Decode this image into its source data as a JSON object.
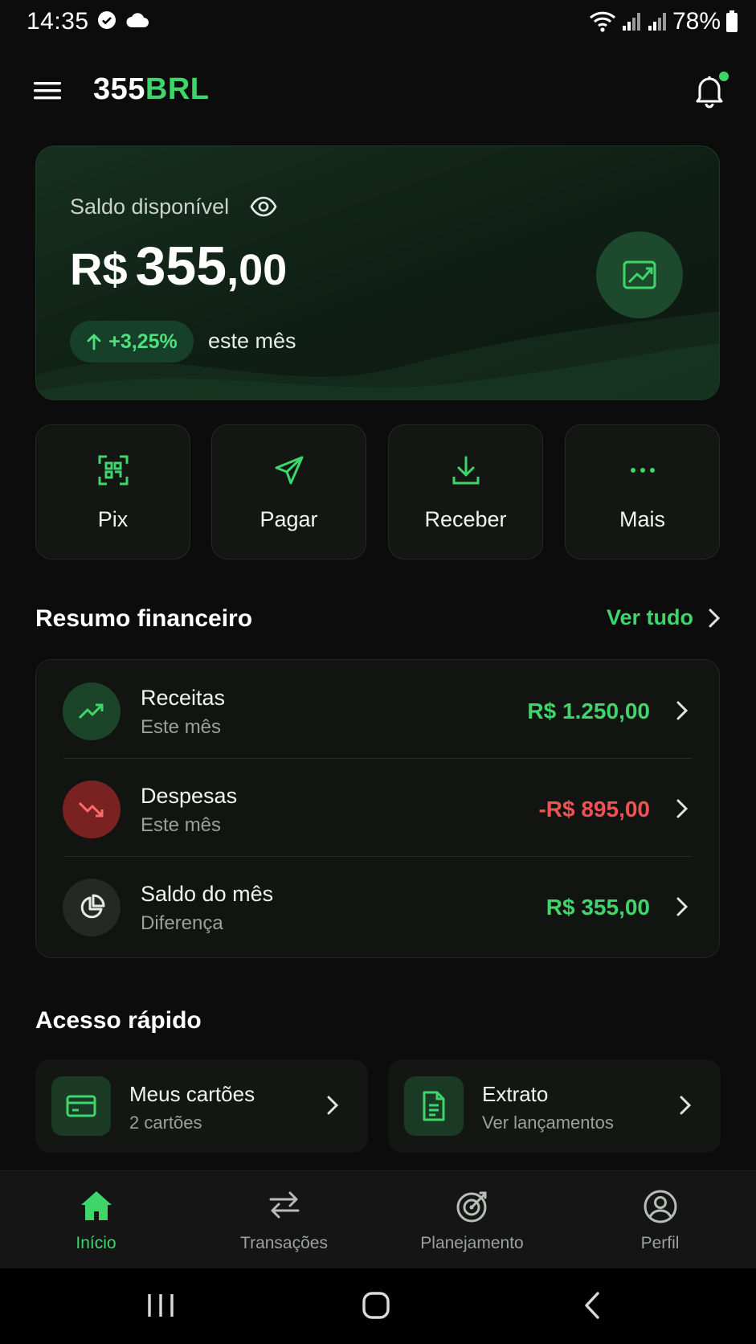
{
  "status_bar": {
    "time": "14:35",
    "battery_text": "78%",
    "icons": [
      "check-circle-icon",
      "cloud-icon",
      "wifi-icon",
      "signal-icon",
      "signal-icon",
      "battery-icon"
    ]
  },
  "header": {
    "brand_number": "355",
    "brand_currency": "BRL",
    "menu_icon": "hamburger-menu-icon",
    "notification_icon": "bell-icon"
  },
  "balance": {
    "label": "Saldo disponível",
    "currency": "R$",
    "integer": "355",
    "decimal": ",00",
    "change": "+3,25%",
    "change_period": "este mês",
    "chart_icon": "chart-trend-icon"
  },
  "actions": [
    {
      "label": "Pix",
      "icon": "pix-qr-icon"
    },
    {
      "label": "Pagar",
      "icon": "send-icon"
    },
    {
      "label": "Receber",
      "icon": "download-icon"
    },
    {
      "label": "Mais",
      "icon": "more-dots-icon"
    }
  ],
  "summary": {
    "title": "Resumo financeiro",
    "see_all": "Ver tudo",
    "rows": [
      {
        "title": "Receitas",
        "subtitle": "Este mês",
        "value": "R$ 1.250,00",
        "icon": "trend-up-icon",
        "color": "#3ed66b"
      },
      {
        "title": "Despesas",
        "subtitle": "Este mês",
        "value": "-R$ 895,00",
        "icon": "trend-down-icon",
        "color": "#f05252"
      },
      {
        "title": "Saldo do mês",
        "subtitle": "Diferença",
        "value": "R$ 355,00",
        "icon": "pie-chart-icon",
        "color": "#3ed66b"
      }
    ]
  },
  "quick_access": {
    "title": "Acesso rápido",
    "items": [
      {
        "title": "Meus cartões",
        "subtitle": "2 cartões",
        "icon": "credit-card-icon"
      },
      {
        "title": "Extrato",
        "subtitle": "Ver lançamentos",
        "icon": "document-icon"
      }
    ]
  },
  "bottom_nav": {
    "active": "Início",
    "items": [
      {
        "label": "Início",
        "icon": "home-icon"
      },
      {
        "label": "Transações",
        "icon": "transfer-arrows-icon"
      },
      {
        "label": "Planejamento",
        "icon": "target-icon"
      },
      {
        "label": "Perfil",
        "icon": "user-icon"
      }
    ]
  },
  "colors": {
    "accent": "#3ed66b",
    "negative": "#f05252",
    "background": "#0b0c0b"
  }
}
